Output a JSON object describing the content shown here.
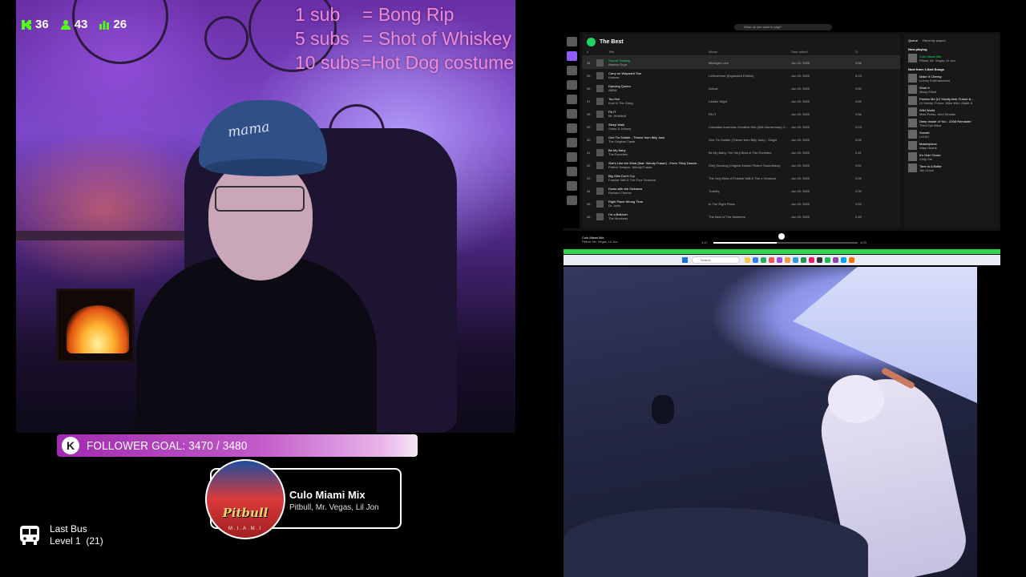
{
  "stream": {
    "stats": [
      {
        "icon": "kick-logo-icon",
        "value": "36",
        "color": "#53fc18"
      },
      {
        "icon": "followers-icon",
        "value": "43",
        "color": "#53fc18"
      },
      {
        "icon": "bar-chart-icon",
        "value": "26",
        "color": "#53fc18"
      }
    ],
    "sub_goals": [
      {
        "count": "1 sub",
        "reward": "= Bong Rip"
      },
      {
        "count": "5 subs",
        "reward": "= Shot of Whiskey"
      },
      {
        "count": "10 subs",
        "reward": "=Hot Dog costume"
      }
    ],
    "sub_goals_color": "#f08ad8",
    "cap_text": "mama",
    "follower_goal": {
      "badge": "K",
      "label": "FOLLOWER GOAL: 3470 / 3480",
      "current": 3470,
      "target": 3480
    },
    "now_playing": {
      "title": "Culo Miami Mix",
      "artists": "Pitbull, Mr. Vegas, Lil Jon",
      "art_name": "Pitbull",
      "art_sub": "M.I.A.M.I"
    },
    "last_bus": {
      "icon": "bus-icon",
      "title": "Last Bus",
      "level": "Level 1  (21)"
    }
  },
  "spotify": {
    "search_placeholder": "What do you want to play?",
    "playlist_title": "The Best",
    "columns": {
      "num": "#",
      "title": "Title",
      "album": "Album",
      "date": "Date added",
      "duration": "◷"
    },
    "tracks": [
      {
        "num": "34",
        "title": "Soccer Healing",
        "artist": "Warrior Guys",
        "album": "Midnight Love",
        "date": "Jun 25, 2025",
        "dur": "3:58",
        "active": true
      },
      {
        "num": "35",
        "title": "Carry on Wayward Son",
        "artist": "Kansas",
        "album": "Leftoverture (Expanded Edition)",
        "date": "Jun 25, 2025",
        "dur": "5:23",
        "active": false
      },
      {
        "num": "36",
        "title": "Dancing Queen",
        "artist": "ABBA",
        "album": "Arrival",
        "date": "Jun 25, 2025",
        "dur": "3:50",
        "active": false
      },
      {
        "num": "37",
        "title": "Too Hot",
        "artist": "Kool & The Gang",
        "album": "Ladies' Night",
        "date": "Jun 25, 2025",
        "dur": "4:59",
        "active": false
      },
      {
        "num": "38",
        "title": "PA IT",
        "artist": "Mr. Whitfield",
        "album": "PA IT",
        "date": "Jun 25, 2025",
        "dur": "2:54",
        "active": false
      },
      {
        "num": "39",
        "title": "Sleep Walk",
        "artist": "Santo & Johnny",
        "album": "Canadian American Greatest Hits (50th Anniversary C...",
        "date": "Jun 25, 2025",
        "dur": "2:23",
        "active": false
      },
      {
        "num": "40",
        "title": "One Tin Soldier - Theme from Billy Jack",
        "artist": "The Original Caste",
        "album": "One Tin Soldier (Theme from Billy Jack) - Single",
        "date": "Jun 25, 2025",
        "dur": "3:26",
        "active": false
      },
      {
        "num": "41",
        "title": "Be My Baby",
        "artist": "The Ronettes",
        "album": "Be My Baby: The Very Best of The Ronettes",
        "date": "Jun 25, 2025",
        "dur": "2:41",
        "active": false
      },
      {
        "num": "42",
        "title": "She's Like the Wind (feat. Wendy Fraser) - From \"Dirty Dancin...",
        "artist": "Patrick Swayze, Wendy Fraser",
        "album": "Dirty Dancing (Original Motion Picture Soundtrack)",
        "date": "Jun 25, 2025",
        "dur": "3:51",
        "active": false
      },
      {
        "num": "43",
        "title": "Big Girls Don't Cry",
        "artist": "Frankie Valli & The Four Seasons",
        "album": "The Very Best of Frankie Valli & The 4 Seasons",
        "date": "Jun 25, 2025",
        "dur": "2:25",
        "active": false
      },
      {
        "num": "44",
        "title": "Down with the Sickness",
        "artist": "Richard Cheese",
        "album": "Tuxicity",
        "date": "Jun 25, 2025",
        "dur": "2:39",
        "active": false
      },
      {
        "num": "45",
        "title": "Right Place Wrong Time",
        "artist": "Dr. John",
        "album": "In The Right Place",
        "date": "Jun 25, 2025",
        "dur": "2:53",
        "active": false
      },
      {
        "num": "46",
        "title": "I'm a Believer",
        "artist": "The Monkees",
        "album": "The Best of The Monkees",
        "date": "Jun 25, 2025",
        "dur": "2:49",
        "active": false
      }
    ],
    "queue": {
      "tabs": [
        "Queue",
        "Recently played"
      ],
      "now_playing_label": "Now playing",
      "now_playing": {
        "title": "Culo Miami Mix",
        "artist": "Pitbull, Mr. Vegas, Lil Jon"
      },
      "next_label": "Next from: Liked Songs",
      "items": [
        {
          "title": "Make It Cheesy",
          "artist": "Luxury Entertainment"
        },
        {
          "title": "Work It",
          "artist": "Missy Elliott"
        },
        {
          "title": "Pardon Me (Lil Yachty feat. Future &...",
          "artist": "Lil Yachty, Future, Mike WiLL Made-It"
        },
        {
          "title": "Wild World",
          "artist": "Maxi Priest, John Sinclair"
        },
        {
          "title": "Deep Inside of You - 2008 Remaster",
          "artist": "Third Eye Blind"
        },
        {
          "title": "Sunset",
          "artist": "LUCKI"
        },
        {
          "title": "Masterpiece",
          "artist": "Atlas Hearts"
        },
        {
          "title": "It's Goin' Down",
          "artist": "Celly Cel"
        },
        {
          "title": "Time Is A Bottle",
          "artist": "Jim Croce"
        }
      ]
    },
    "player": {
      "title": "Culo Miami Mix",
      "artist": "Pitbull, Mr. Vegas, Lil Jon",
      "elapsed": "1:47",
      "total": "4:03",
      "progress": 0.44
    }
  },
  "taskbar": {
    "search": "Search",
    "app_colors": [
      "#f2c94c",
      "#2f80ed",
      "#27ae60",
      "#eb5757",
      "#9b51e0",
      "#f2994a",
      "#2d9cdb",
      "#219653",
      "#e91e63",
      "#333333",
      "#1db954",
      "#8e44ad",
      "#00a4ef",
      "#ff6f00"
    ]
  }
}
